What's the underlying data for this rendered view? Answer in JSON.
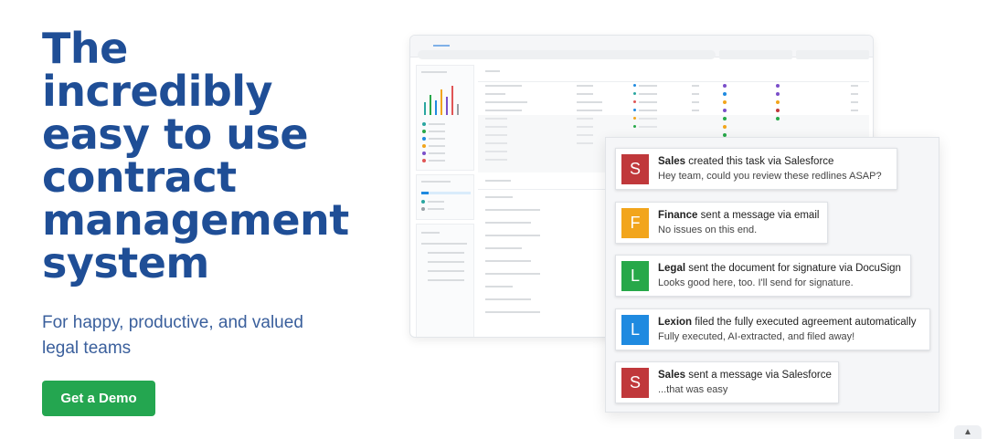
{
  "hero": {
    "title_lines": [
      "The",
      "incredibly",
      "easy to use",
      "contract",
      "management",
      "system"
    ],
    "subtitle_line1": "For happy, productive, and valued",
    "subtitle_line2": "legal teams",
    "cta_label": "Get a Demo"
  },
  "feed": {
    "items": [
      {
        "initial": "S",
        "actor": "Sales",
        "action": "created this task via Salesforce",
        "message": "Hey team, could you review these redlines ASAP?",
        "color": "#c0383b"
      },
      {
        "initial": "F",
        "actor": "Finance",
        "action": "sent a message via email",
        "message": "No issues on this end.",
        "color": "#f2a51c"
      },
      {
        "initial": "L",
        "actor": "Legal",
        "action": "sent the document for signature via DocuSign",
        "message": "Looks good here, too. I'll send for signature.",
        "color": "#27a849"
      },
      {
        "initial": "L",
        "actor": "Lexion",
        "action": "filed the fully executed agreement automatically",
        "message": "Fully executed, AI-extracted, and filed away!",
        "color": "#1f8ae0"
      },
      {
        "initial": "S",
        "actor": "Sales",
        "action": "sent a message via Salesforce",
        "message": "...that was easy",
        "color": "#c0383b"
      }
    ]
  },
  "colors": {
    "title": "#1f4e96",
    "subtitle": "#3a5f9c",
    "cta": "#24a650"
  },
  "icons": {
    "scroll_top": "chevron-up-icon"
  }
}
